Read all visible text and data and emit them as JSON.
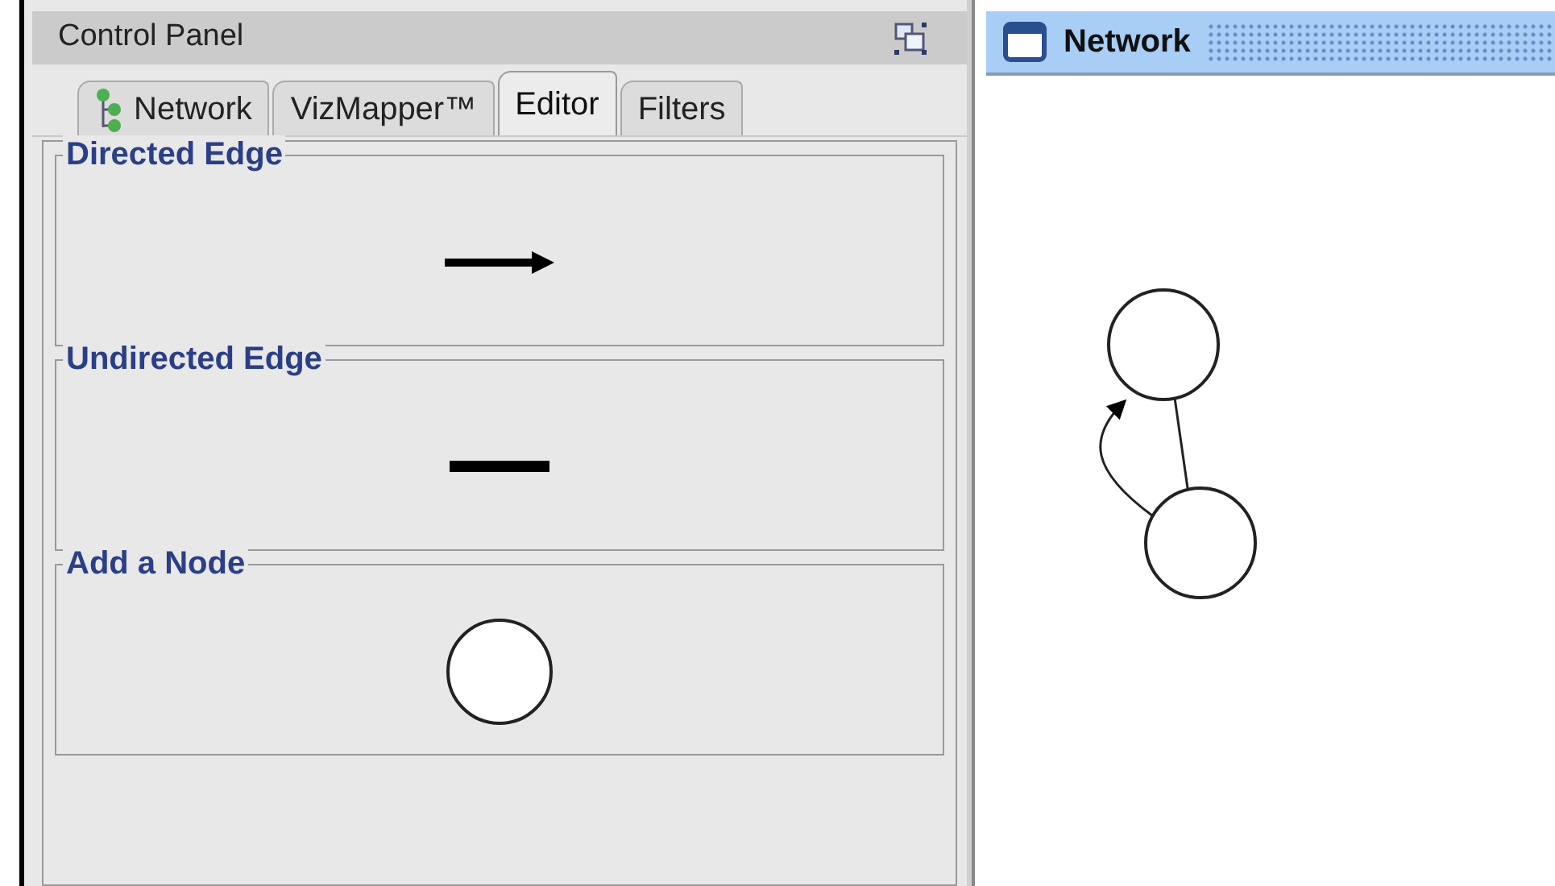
{
  "control_panel": {
    "title": "Control Panel",
    "tabs": [
      {
        "label": "Network",
        "selected": false,
        "icon": true
      },
      {
        "label": "VizMapper™",
        "selected": false
      },
      {
        "label": "Editor",
        "selected": true
      },
      {
        "label": "Filters",
        "selected": false
      }
    ],
    "sections": [
      {
        "title": "Directed Edge",
        "kind": "directed_edge"
      },
      {
        "title": "Undirected Edge",
        "kind": "undirected_edge"
      },
      {
        "title": "Add a Node",
        "kind": "node"
      }
    ]
  },
  "network_window": {
    "title": "Network"
  }
}
